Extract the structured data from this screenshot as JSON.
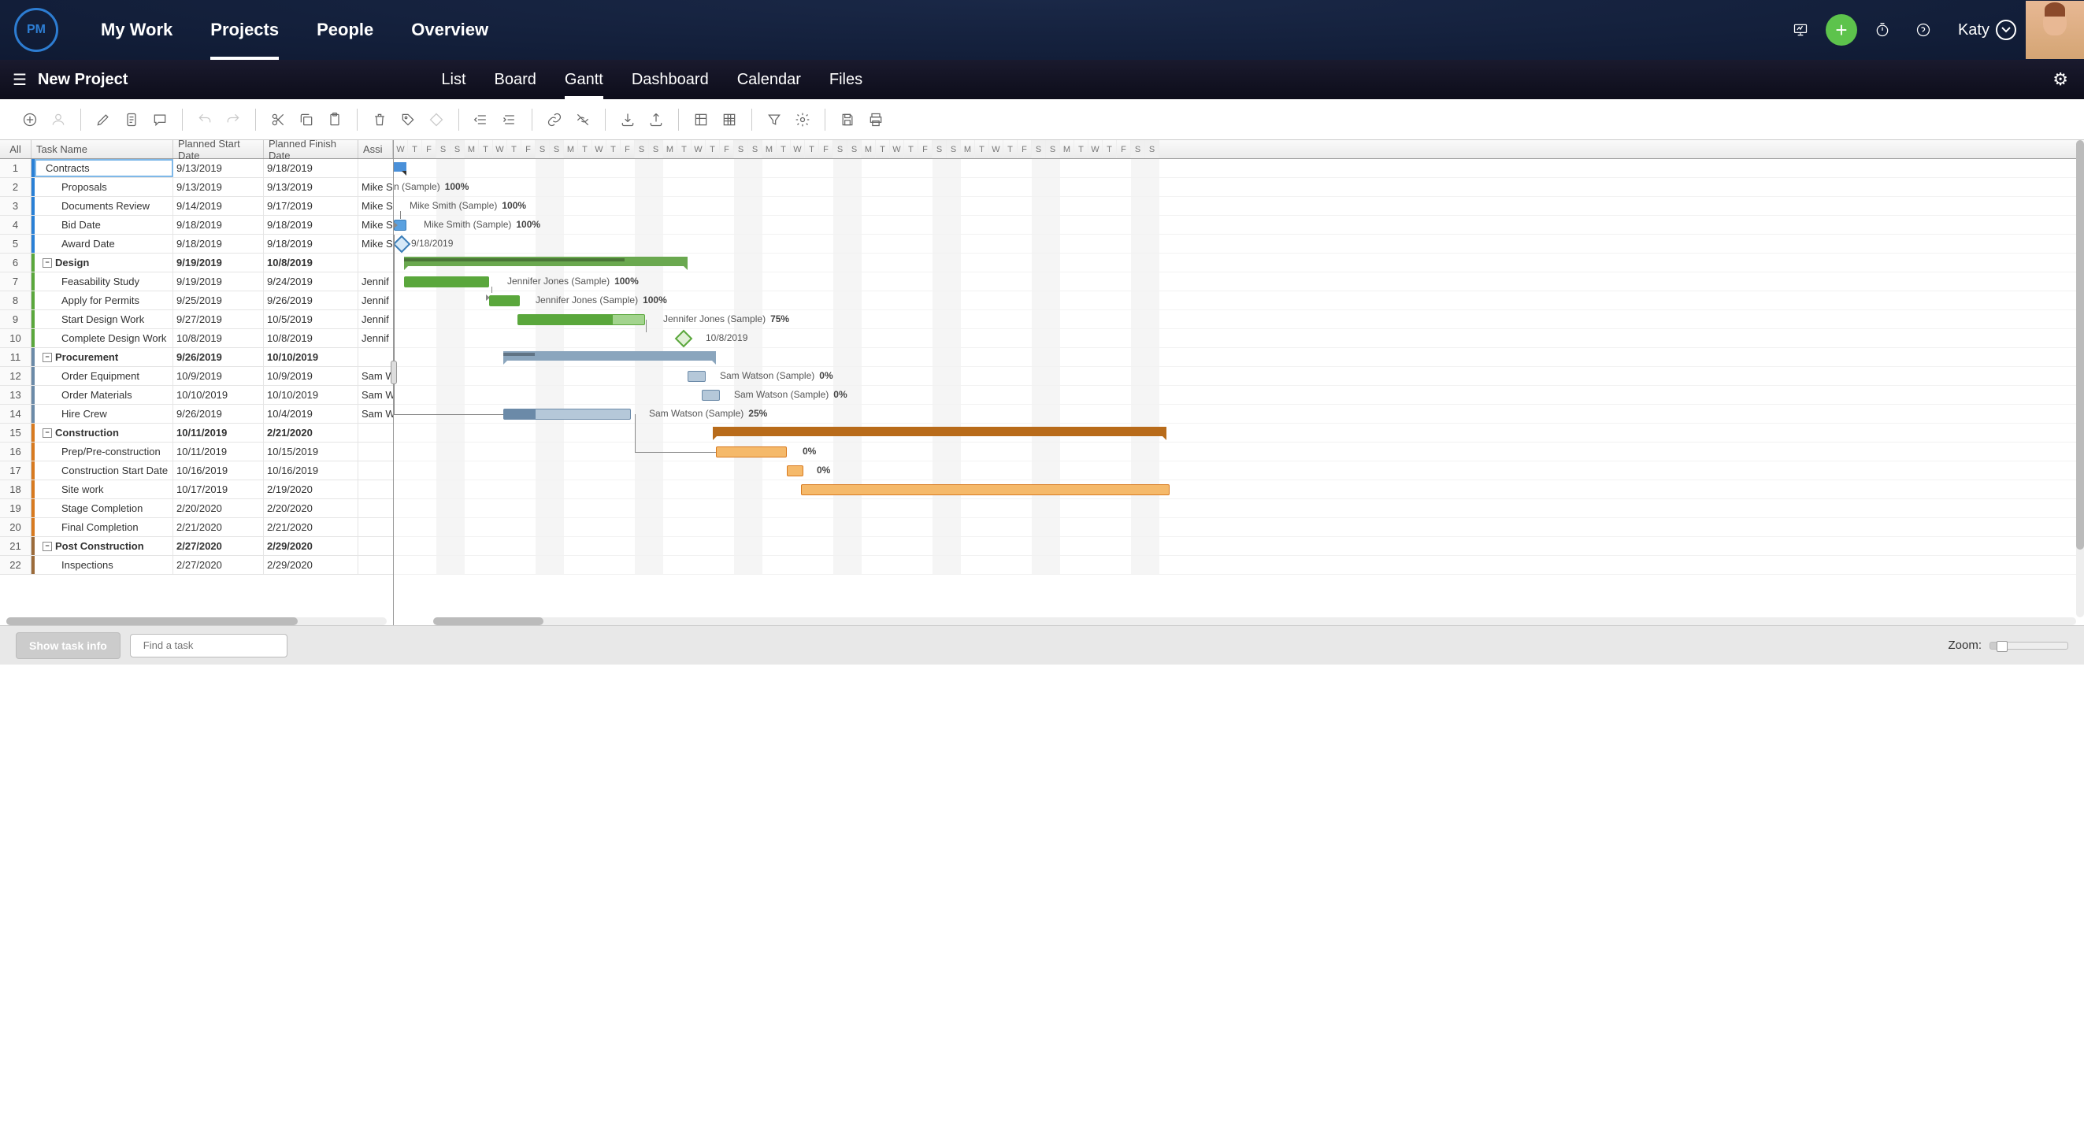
{
  "topnav": {
    "logo": "PM",
    "items": [
      "My Work",
      "Projects",
      "People",
      "Overview"
    ],
    "active": 1,
    "user": "Katy"
  },
  "subnav": {
    "title": "New Project",
    "tabs": [
      "List",
      "Board",
      "Gantt",
      "Dashboard",
      "Calendar",
      "Files"
    ],
    "active": 2
  },
  "grid": {
    "headers": {
      "all": "All",
      "name": "Task Name",
      "start": "Planned Start Date",
      "finish": "Planned Finish Date",
      "assigned": "Assi"
    },
    "rows": [
      {
        "id": 1,
        "name": "Contracts",
        "start": "9/13/2019",
        "finish": "9/18/2019",
        "ass": "",
        "color": "blue",
        "indent": 1
      },
      {
        "id": 2,
        "name": "Proposals",
        "start": "9/13/2019",
        "finish": "9/13/2019",
        "ass": "Mike S",
        "color": "blue",
        "indent": 2
      },
      {
        "id": 3,
        "name": "Documents Review",
        "start": "9/14/2019",
        "finish": "9/17/2019",
        "ass": "Mike S",
        "color": "blue",
        "indent": 2
      },
      {
        "id": 4,
        "name": "Bid Date",
        "start": "9/18/2019",
        "finish": "9/18/2019",
        "ass": "Mike S",
        "color": "blue",
        "indent": 2
      },
      {
        "id": 5,
        "name": "Award Date",
        "start": "9/18/2019",
        "finish": "9/18/2019",
        "ass": "Mike S",
        "color": "blue",
        "indent": 2
      },
      {
        "id": 6,
        "name": "Design",
        "start": "9/19/2019",
        "finish": "10/8/2019",
        "ass": "",
        "color": "green",
        "indent": 0,
        "group": true
      },
      {
        "id": 7,
        "name": "Feasability Study",
        "start": "9/19/2019",
        "finish": "9/24/2019",
        "ass": "Jennif",
        "color": "green",
        "indent": 2
      },
      {
        "id": 8,
        "name": "Apply for Permits",
        "start": "9/25/2019",
        "finish": "9/26/2019",
        "ass": "Jennif",
        "color": "green",
        "indent": 2
      },
      {
        "id": 9,
        "name": "Start Design Work",
        "start": "9/27/2019",
        "finish": "10/5/2019",
        "ass": "Jennif",
        "color": "green",
        "indent": 2
      },
      {
        "id": 10,
        "name": "Complete Design Work",
        "start": "10/8/2019",
        "finish": "10/8/2019",
        "ass": "Jennif",
        "color": "green",
        "indent": 2
      },
      {
        "id": 11,
        "name": "Procurement",
        "start": "9/26/2019",
        "finish": "10/10/2019",
        "ass": "",
        "color": "slate",
        "indent": 0,
        "group": true
      },
      {
        "id": 12,
        "name": "Order Equipment",
        "start": "10/9/2019",
        "finish": "10/9/2019",
        "ass": "Sam W",
        "color": "slate",
        "indent": 2
      },
      {
        "id": 13,
        "name": "Order Materials",
        "start": "10/10/2019",
        "finish": "10/10/2019",
        "ass": "Sam W",
        "color": "slate",
        "indent": 2
      },
      {
        "id": 14,
        "name": "Hire Crew",
        "start": "9/26/2019",
        "finish": "10/4/2019",
        "ass": "Sam W",
        "color": "slate",
        "indent": 2
      },
      {
        "id": 15,
        "name": "Construction",
        "start": "10/11/2019",
        "finish": "2/21/2020",
        "ass": "",
        "color": "orange",
        "indent": 0,
        "group": true
      },
      {
        "id": 16,
        "name": "Prep/Pre-construction",
        "start": "10/11/2019",
        "finish": "10/15/2019",
        "ass": "",
        "color": "orange",
        "indent": 2
      },
      {
        "id": 17,
        "name": "Construction Start Date",
        "start": "10/16/2019",
        "finish": "10/16/2019",
        "ass": "",
        "color": "orange",
        "indent": 2
      },
      {
        "id": 18,
        "name": "Site work",
        "start": "10/17/2019",
        "finish": "2/19/2020",
        "ass": "",
        "color": "orange",
        "indent": 2
      },
      {
        "id": 19,
        "name": "Stage Completion",
        "start": "2/20/2020",
        "finish": "2/20/2020",
        "ass": "",
        "color": "orange",
        "indent": 2
      },
      {
        "id": 20,
        "name": "Final Completion",
        "start": "2/21/2020",
        "finish": "2/21/2020",
        "ass": "",
        "color": "orange",
        "indent": 2
      },
      {
        "id": 21,
        "name": "Post Construction",
        "start": "2/27/2020",
        "finish": "2/29/2020",
        "ass": "",
        "color": "brown",
        "indent": 0,
        "group": true
      },
      {
        "id": 22,
        "name": "Inspections",
        "start": "2/27/2020",
        "finish": "2/29/2020",
        "ass": "",
        "color": "brown",
        "indent": 2
      }
    ]
  },
  "gantt": {
    "days": [
      "W",
      "T",
      "F",
      "S",
      "S",
      "M",
      "T",
      "W",
      "T",
      "F",
      "S",
      "S",
      "M",
      "T",
      "W",
      "T",
      "F",
      "S",
      "S",
      "M",
      "T",
      "W",
      "T",
      "F",
      "S",
      "S",
      "M",
      "T",
      "W",
      "T",
      "F",
      "S",
      "S",
      "M",
      "T",
      "W",
      "T",
      "F",
      "S",
      "S",
      "M",
      "T",
      "W",
      "T",
      "F",
      "S",
      "S",
      "M",
      "T",
      "W",
      "T",
      "F",
      "S",
      "S"
    ],
    "labels": {
      "r2": {
        "name": "n (Sample)",
        "pct": "100%"
      },
      "r3": {
        "name": "Mike Smith (Sample)",
        "pct": "100%"
      },
      "r4": {
        "name": "Mike Smith (Sample)",
        "pct": "100%"
      },
      "r5": {
        "name": "9/18/2019"
      },
      "r7": {
        "name": "Jennifer Jones (Sample)",
        "pct": "100%"
      },
      "r8": {
        "name": "Jennifer Jones (Sample)",
        "pct": "100%"
      },
      "r9": {
        "name": "Jennifer Jones (Sample)",
        "pct": "75%"
      },
      "r10": {
        "name": "10/8/2019"
      },
      "r12": {
        "name": "Sam Watson (Sample)",
        "pct": "0%"
      },
      "r13": {
        "name": "Sam Watson (Sample)",
        "pct": "0%"
      },
      "r14": {
        "name": "Sam Watson (Sample)",
        "pct": "25%"
      },
      "r16": {
        "pct": "0%"
      },
      "r17": {
        "pct": "0%"
      }
    }
  },
  "footer": {
    "showInfo": "Show task info",
    "searchPlaceholder": "Find a task",
    "zoom": "Zoom:"
  }
}
